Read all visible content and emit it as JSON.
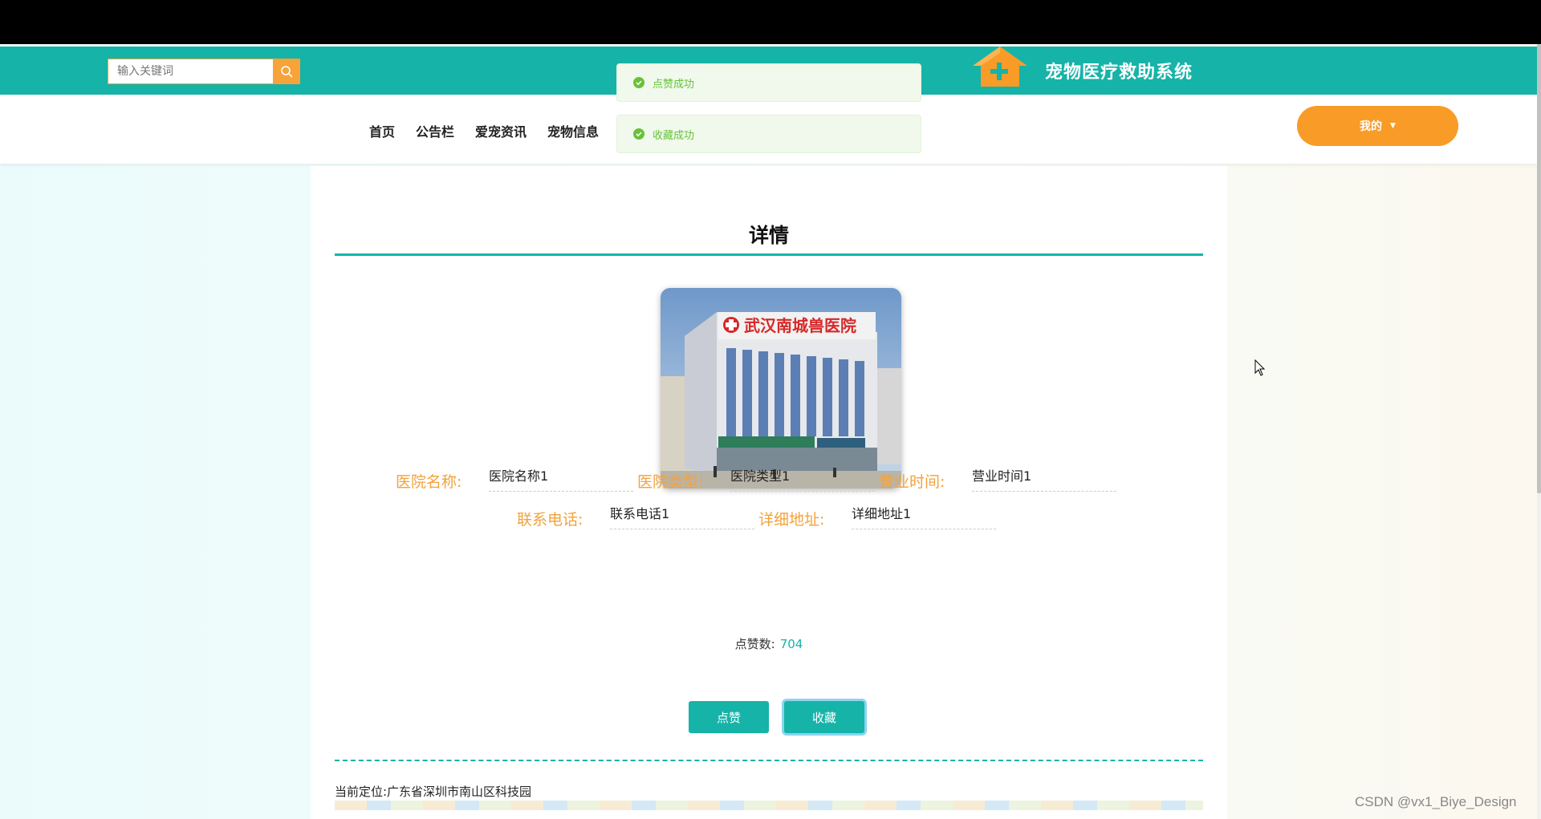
{
  "app": {
    "title": "宠物医疗救助系统"
  },
  "search": {
    "placeholder": "输入关键词"
  },
  "nav": {
    "items": [
      "首页",
      "公告栏",
      "爱宠资讯",
      "宠物信息"
    ],
    "my_label": "我的"
  },
  "toasts": [
    "点赞成功",
    "收藏成功"
  ],
  "detail": {
    "title": "详情",
    "fields": [
      {
        "label": "医院名称:",
        "value": "医院名称1"
      },
      {
        "label": "医院类型:",
        "value": "医院类型1"
      },
      {
        "label": "营业时间:",
        "value": "营业时间1"
      },
      {
        "label": "联系电话:",
        "value": "联系电话1"
      },
      {
        "label": "详细地址:",
        "value": "详细地址1"
      }
    ],
    "like_count_label": "点赞数:",
    "like_count": "704",
    "like_button": "点赞",
    "favorite_button": "收藏",
    "location": "当前定位:广东省深圳市南山区科技园"
  },
  "photo_sign": "武汉南城兽医院",
  "watermark": "CSDN @vx1_Biye_Design",
  "colors": {
    "primary": "#16b3a8",
    "accent": "#f99b27",
    "label": "#f3a23c",
    "success": "#67c23a"
  }
}
